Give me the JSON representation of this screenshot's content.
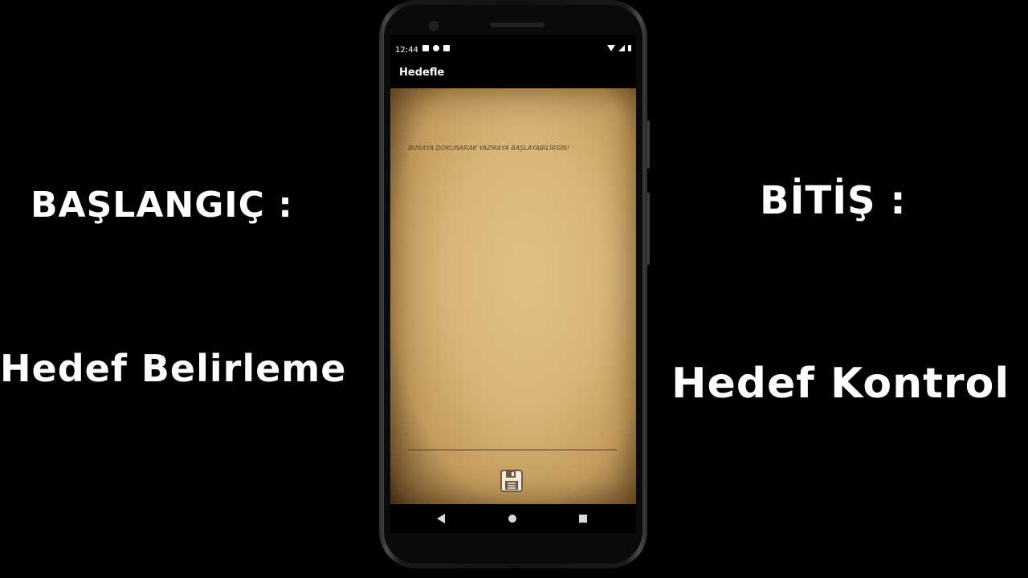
{
  "overlay": {
    "left_title": "BAŞLANGIÇ :",
    "left_subtitle": "Hedef Belirleme",
    "right_title": "BİTİŞ :",
    "right_subtitle": "Hedef Kontrol"
  },
  "status_bar": {
    "time": "12:44"
  },
  "app_bar": {
    "title": "Hedefle"
  },
  "editor": {
    "placeholder": "BURAYA DOKUNARAK YAZMAYA BAŞLAYABİLİRSİN!",
    "save_icon": "floppy-disk-icon"
  },
  "nav_bar": {
    "back_icon": "back-triangle-icon",
    "home_icon": "home-circle-icon",
    "recents_icon": "recents-square-icon"
  }
}
